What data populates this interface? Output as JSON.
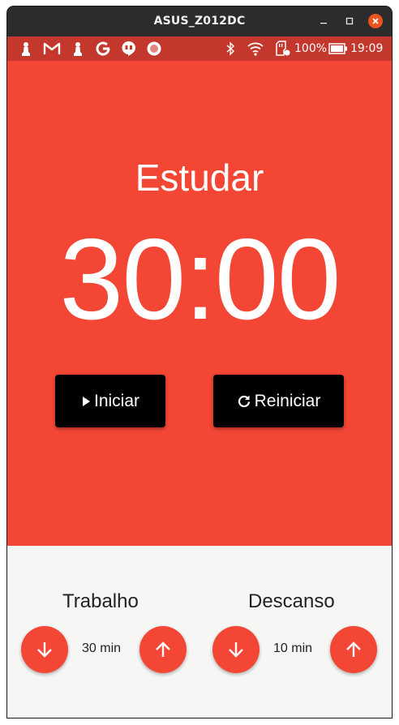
{
  "window": {
    "title": "ASUS_Z012DC"
  },
  "statusbar": {
    "battery": "100%",
    "clock": "19:09"
  },
  "timer": {
    "mode": "Estudar",
    "time": "30:00"
  },
  "actions": {
    "start_label": "Iniciar",
    "reset_label": "Reiniciar"
  },
  "work": {
    "title": "Trabalho",
    "value": "30 min"
  },
  "rest": {
    "title": "Descanso",
    "value": "10 min"
  },
  "colors": {
    "primary": "#f44634",
    "statusbar": "#c4372c",
    "button": "#000000",
    "bottom_bg": "#f6f7f5"
  },
  "icons": [
    "chess-pawn-icon",
    "gmail-icon",
    "chess-pawn-icon",
    "google-icon",
    "hangouts-icon",
    "record-icon",
    "bluetooth-icon",
    "wifi-icon",
    "sd-card-icon",
    "battery-icon",
    "play-icon",
    "refresh-icon",
    "arrow-down-icon",
    "arrow-up-icon"
  ]
}
